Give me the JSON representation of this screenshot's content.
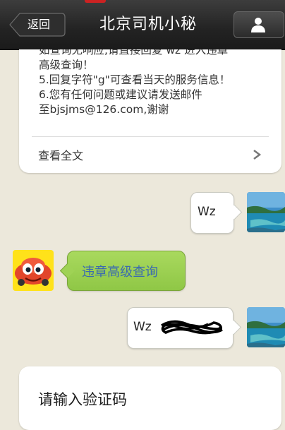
{
  "header": {
    "back_label": "返回",
    "title": "北京司机小秘",
    "profile_icon": "person-icon"
  },
  "info_card": {
    "lines": [
      "如查询无响应,请直接回复 wz 进入违章",
      "高级查询！",
      "5.回复字符\"g\"可查看当天的服务信息！",
      "6.您有任何问题或建议请发送邮件",
      "至bjsjms@126.com,谢谢"
    ],
    "read_more_label": "查看全文",
    "read_more_icon": "chevron-right-icon"
  },
  "messages": [
    {
      "side": "right",
      "text": "Wz",
      "avatar": "landscape-photo"
    },
    {
      "side": "left",
      "text": "违章高级查询",
      "avatar": "cartoon-car"
    },
    {
      "side": "right",
      "text": "Wz",
      "avatar": "landscape-photo"
    }
  ],
  "bottom_card": {
    "text": "请输入验证码"
  },
  "colors": {
    "background": "#ece8db",
    "bubble_green": "#9fd255",
    "link_blue": "#3a6ab0"
  }
}
